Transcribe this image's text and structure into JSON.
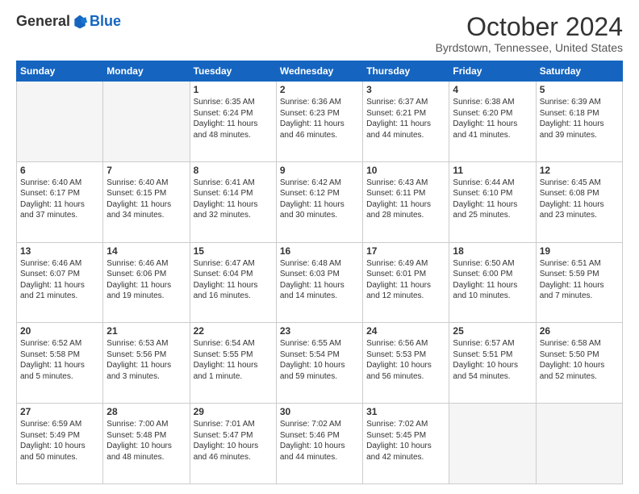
{
  "logo": {
    "general": "General",
    "blue": "Blue"
  },
  "title": "October 2024",
  "location": "Byrdstown, Tennessee, United States",
  "headers": [
    "Sunday",
    "Monday",
    "Tuesday",
    "Wednesday",
    "Thursday",
    "Friday",
    "Saturday"
  ],
  "rows": [
    [
      {
        "day": "",
        "text": ""
      },
      {
        "day": "",
        "text": ""
      },
      {
        "day": "1",
        "text": "Sunrise: 6:35 AM\nSunset: 6:24 PM\nDaylight: 11 hours and 48 minutes."
      },
      {
        "day": "2",
        "text": "Sunrise: 6:36 AM\nSunset: 6:23 PM\nDaylight: 11 hours and 46 minutes."
      },
      {
        "day": "3",
        "text": "Sunrise: 6:37 AM\nSunset: 6:21 PM\nDaylight: 11 hours and 44 minutes."
      },
      {
        "day": "4",
        "text": "Sunrise: 6:38 AM\nSunset: 6:20 PM\nDaylight: 11 hours and 41 minutes."
      },
      {
        "day": "5",
        "text": "Sunrise: 6:39 AM\nSunset: 6:18 PM\nDaylight: 11 hours and 39 minutes."
      }
    ],
    [
      {
        "day": "6",
        "text": "Sunrise: 6:40 AM\nSunset: 6:17 PM\nDaylight: 11 hours and 37 minutes."
      },
      {
        "day": "7",
        "text": "Sunrise: 6:40 AM\nSunset: 6:15 PM\nDaylight: 11 hours and 34 minutes."
      },
      {
        "day": "8",
        "text": "Sunrise: 6:41 AM\nSunset: 6:14 PM\nDaylight: 11 hours and 32 minutes."
      },
      {
        "day": "9",
        "text": "Sunrise: 6:42 AM\nSunset: 6:12 PM\nDaylight: 11 hours and 30 minutes."
      },
      {
        "day": "10",
        "text": "Sunrise: 6:43 AM\nSunset: 6:11 PM\nDaylight: 11 hours and 28 minutes."
      },
      {
        "day": "11",
        "text": "Sunrise: 6:44 AM\nSunset: 6:10 PM\nDaylight: 11 hours and 25 minutes."
      },
      {
        "day": "12",
        "text": "Sunrise: 6:45 AM\nSunset: 6:08 PM\nDaylight: 11 hours and 23 minutes."
      }
    ],
    [
      {
        "day": "13",
        "text": "Sunrise: 6:46 AM\nSunset: 6:07 PM\nDaylight: 11 hours and 21 minutes."
      },
      {
        "day": "14",
        "text": "Sunrise: 6:46 AM\nSunset: 6:06 PM\nDaylight: 11 hours and 19 minutes."
      },
      {
        "day": "15",
        "text": "Sunrise: 6:47 AM\nSunset: 6:04 PM\nDaylight: 11 hours and 16 minutes."
      },
      {
        "day": "16",
        "text": "Sunrise: 6:48 AM\nSunset: 6:03 PM\nDaylight: 11 hours and 14 minutes."
      },
      {
        "day": "17",
        "text": "Sunrise: 6:49 AM\nSunset: 6:01 PM\nDaylight: 11 hours and 12 minutes."
      },
      {
        "day": "18",
        "text": "Sunrise: 6:50 AM\nSunset: 6:00 PM\nDaylight: 11 hours and 10 minutes."
      },
      {
        "day": "19",
        "text": "Sunrise: 6:51 AM\nSunset: 5:59 PM\nDaylight: 11 hours and 7 minutes."
      }
    ],
    [
      {
        "day": "20",
        "text": "Sunrise: 6:52 AM\nSunset: 5:58 PM\nDaylight: 11 hours and 5 minutes."
      },
      {
        "day": "21",
        "text": "Sunrise: 6:53 AM\nSunset: 5:56 PM\nDaylight: 11 hours and 3 minutes."
      },
      {
        "day": "22",
        "text": "Sunrise: 6:54 AM\nSunset: 5:55 PM\nDaylight: 11 hours and 1 minute."
      },
      {
        "day": "23",
        "text": "Sunrise: 6:55 AM\nSunset: 5:54 PM\nDaylight: 10 hours and 59 minutes."
      },
      {
        "day": "24",
        "text": "Sunrise: 6:56 AM\nSunset: 5:53 PM\nDaylight: 10 hours and 56 minutes."
      },
      {
        "day": "25",
        "text": "Sunrise: 6:57 AM\nSunset: 5:51 PM\nDaylight: 10 hours and 54 minutes."
      },
      {
        "day": "26",
        "text": "Sunrise: 6:58 AM\nSunset: 5:50 PM\nDaylight: 10 hours and 52 minutes."
      }
    ],
    [
      {
        "day": "27",
        "text": "Sunrise: 6:59 AM\nSunset: 5:49 PM\nDaylight: 10 hours and 50 minutes."
      },
      {
        "day": "28",
        "text": "Sunrise: 7:00 AM\nSunset: 5:48 PM\nDaylight: 10 hours and 48 minutes."
      },
      {
        "day": "29",
        "text": "Sunrise: 7:01 AM\nSunset: 5:47 PM\nDaylight: 10 hours and 46 minutes."
      },
      {
        "day": "30",
        "text": "Sunrise: 7:02 AM\nSunset: 5:46 PM\nDaylight: 10 hours and 44 minutes."
      },
      {
        "day": "31",
        "text": "Sunrise: 7:02 AM\nSunset: 5:45 PM\nDaylight: 10 hours and 42 minutes."
      },
      {
        "day": "",
        "text": ""
      },
      {
        "day": "",
        "text": ""
      }
    ]
  ]
}
